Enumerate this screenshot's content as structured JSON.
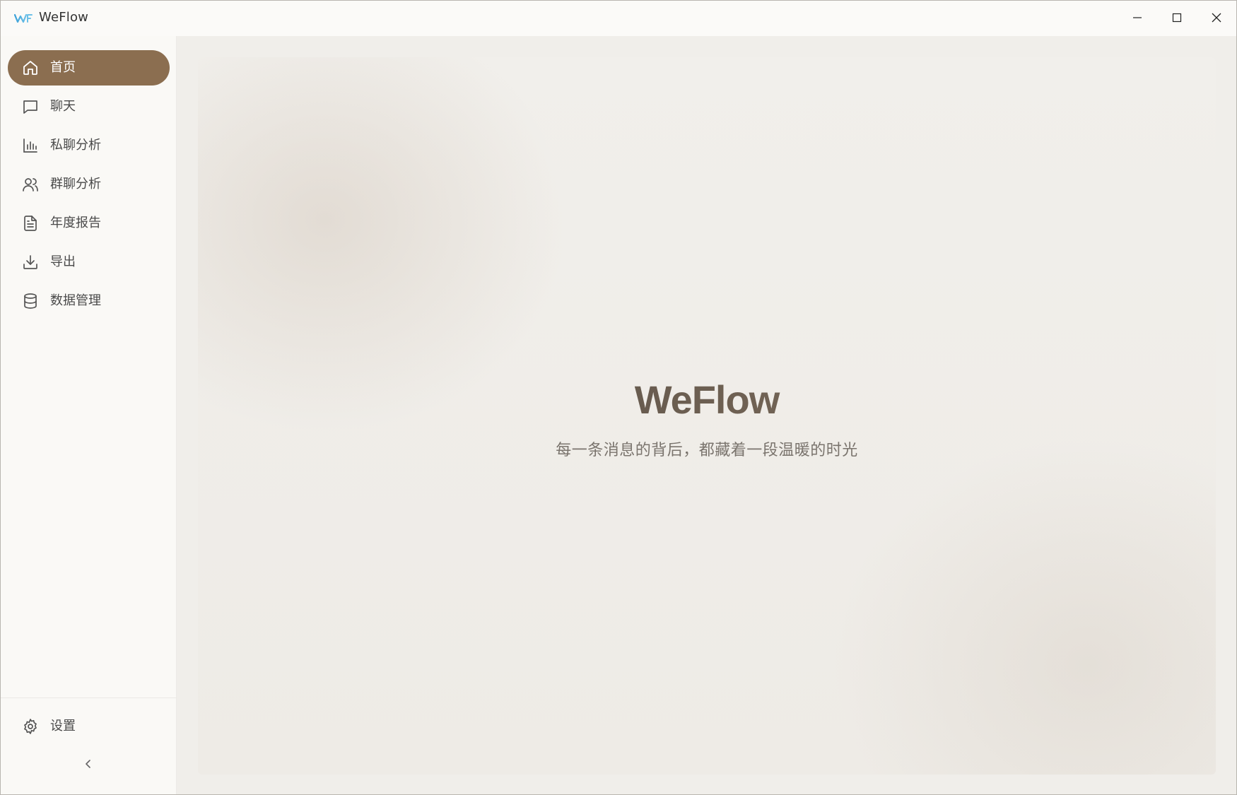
{
  "window": {
    "title": "WeFlow",
    "controls": {
      "minimize_icon": "minimize-icon",
      "maximize_icon": "maximize-icon",
      "close_icon": "close-icon"
    }
  },
  "sidebar": {
    "items": [
      {
        "label": "首页",
        "icon": "home-icon",
        "active": true
      },
      {
        "label": "聊天",
        "icon": "chat-bubble-icon",
        "active": false
      },
      {
        "label": "私聊分析",
        "icon": "bar-chart-icon",
        "active": false
      },
      {
        "label": "群聊分析",
        "icon": "users-icon",
        "active": false
      },
      {
        "label": "年度报告",
        "icon": "document-icon",
        "active": false
      },
      {
        "label": "导出",
        "icon": "download-icon",
        "active": false
      },
      {
        "label": "数据管理",
        "icon": "database-icon",
        "active": false
      }
    ],
    "settings": {
      "label": "设置",
      "icon": "gear-icon"
    },
    "collapse_icon": "chevron-left-icon"
  },
  "main": {
    "hero_title": "WeFlow",
    "hero_subtitle": "每一条消息的背后，都藏着一段温暖的时光"
  },
  "colors": {
    "accent": "#8b6e50",
    "sidebar_bg": "#faf9f6",
    "content_bg": "#f0eeea"
  }
}
